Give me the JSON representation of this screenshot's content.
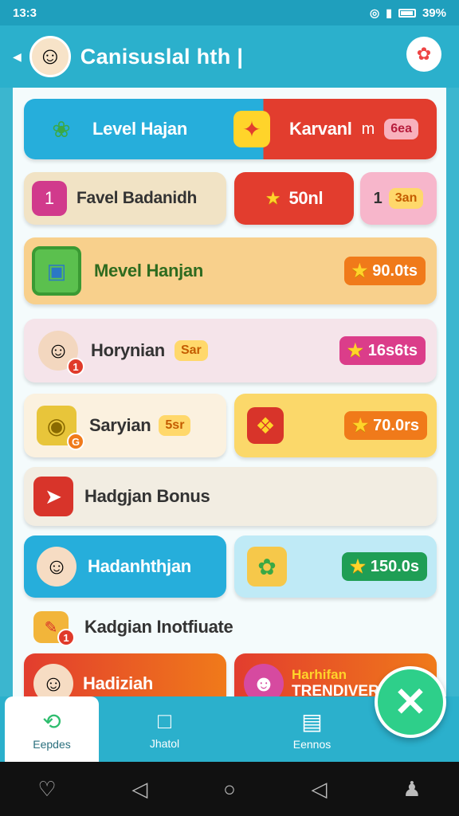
{
  "status_bar": {
    "time": "13:3",
    "battery": "39%"
  },
  "header": {
    "title": "Canisuslal hth |"
  },
  "cards": {
    "level_hajan": {
      "label": "Level Hajan",
      "right_label": "Karvanl",
      "right_num": "m",
      "right_badge": "6ea"
    },
    "favel": {
      "label": "Favel Badanidh",
      "red_value": "50nl",
      "pink_num": "1",
      "pink_badge": "3an"
    },
    "mevel": {
      "label": "Mevel Hanjan",
      "value": "90.0ts"
    },
    "horynian": {
      "label": "Horynian",
      "mini": "Sar",
      "value": "16s6ts",
      "badge": "1"
    },
    "saryian": {
      "label": "Saryian",
      "mini": "5sr",
      "value": "70.0rs",
      "badge": "G"
    },
    "hadgjan": {
      "label": "Hadgjan Bonus"
    },
    "hadanhthjan": {
      "label": "Hadanhthjan",
      "value": "150.0s"
    },
    "kadgian": {
      "label": "Kadgian Inotfiuate",
      "badge": "1"
    },
    "hadiziah": {
      "label": "Hadiziah",
      "right_title": "Harhifan",
      "right_sub": "TRENDIVERI"
    }
  },
  "nav": {
    "items": [
      {
        "label": "Eepdes",
        "icon": "home-icon"
      },
      {
        "label": "Jhatol",
        "icon": "folder-icon"
      },
      {
        "label": "Eennos",
        "icon": "message-icon"
      }
    ]
  },
  "fab": {
    "icon": "close-icon"
  },
  "colors": {
    "header": "#2bb0cc",
    "blue_card": "#26aedb",
    "red": "#e23d2e",
    "orange_pill": "#f07a1a",
    "pink_pill": "#db3d8a",
    "green_pill": "#1f9e55",
    "fab": "#2ecf8a"
  }
}
